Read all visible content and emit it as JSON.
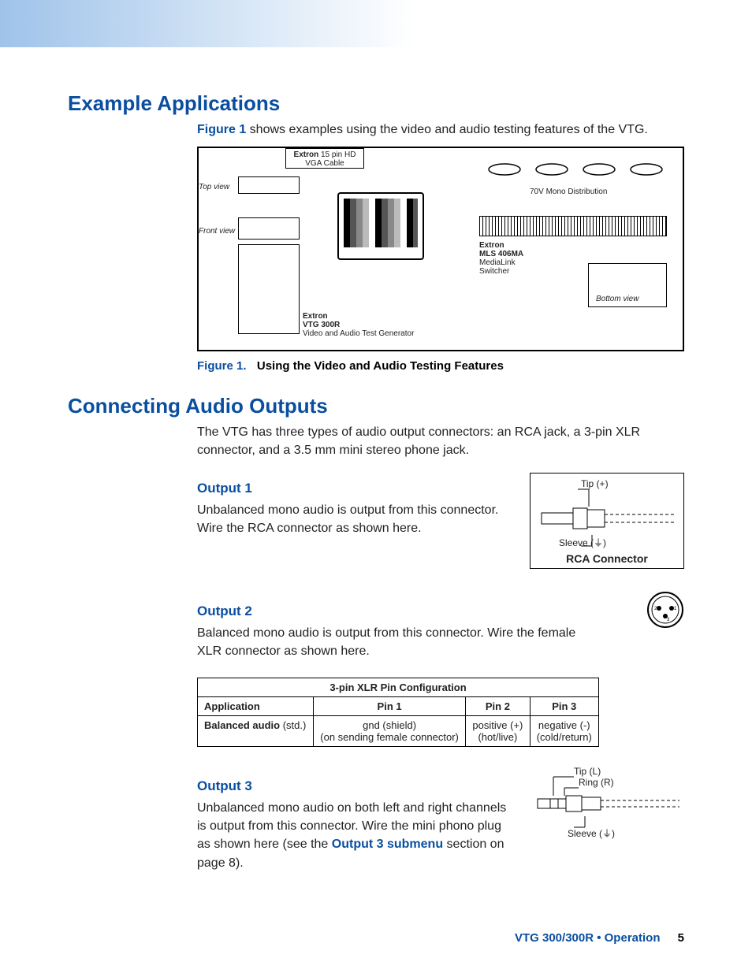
{
  "sections": {
    "example_apps": {
      "title": "Example Applications",
      "intro_lead": "Figure 1",
      "intro_rest": " shows examples using the video and audio testing features of the VTG."
    },
    "figure1": {
      "top_view": "Top view",
      "front_view": "Front view",
      "cable_label_brand": "Extron",
      "cable_label_rest": " 15 pin HD\nVGA Cable",
      "vtg_brand": "Extron",
      "vtg_model": "VTG 300R",
      "vtg_desc": "Video and Audio Test Generator",
      "dist": "70V Mono Distribution",
      "mls_brand": "Extron",
      "mls_model": "MLS 406MA",
      "mls_desc1": "MediaLink",
      "mls_desc2": "Switcher",
      "bottom_view": "Bottom view",
      "caption_lead": "Figure 1.",
      "caption_desc": "Using the Video and Audio Testing Features"
    },
    "connecting": {
      "title": "Connecting Audio Outputs",
      "intro": "The VTG has three types of audio output connectors: an RCA jack, a 3-pin XLR connector, and a 3.5 mm mini stereo phone jack."
    },
    "output1": {
      "title": "Output 1",
      "body": "Unbalanced mono audio is output from this connector. Wire the RCA connector as shown here.",
      "tip": "Tip (+)",
      "sleeve": "Sleeve (⏚)",
      "caption": "RCA Connector"
    },
    "output2": {
      "title": "Output 2",
      "body": "Balanced mono audio is output from this connector. Wire the female XLR connector as shown here.",
      "table": {
        "title": "3-pin XLR Pin Configuration",
        "headers": [
          "Application",
          "Pin 1",
          "Pin 2",
          "Pin 3"
        ],
        "row_label_bold": "Balanced audio",
        "row_label_rest": " (std.)",
        "pin1_a": "gnd (shield)",
        "pin1_b": "(on sending female connector)",
        "pin2_a": "positive (+)",
        "pin2_b": "(hot/live)",
        "pin3_a": "negative (-)",
        "pin3_b": "(cold/return)"
      }
    },
    "output3": {
      "title": "Output 3",
      "body_a": "Unbalanced mono audio on both left and right channels is output from this connector. Wire the mini phono plug as shown here (see the ",
      "link": "Output 3 submenu",
      "body_b": " section on page 8).",
      "tip": "Tip (L)",
      "ring": "Ring (R)",
      "sleeve": "Sleeve (⏚)"
    }
  },
  "footer": {
    "text": "VTG 300/300R • Operation",
    "page": "5"
  }
}
